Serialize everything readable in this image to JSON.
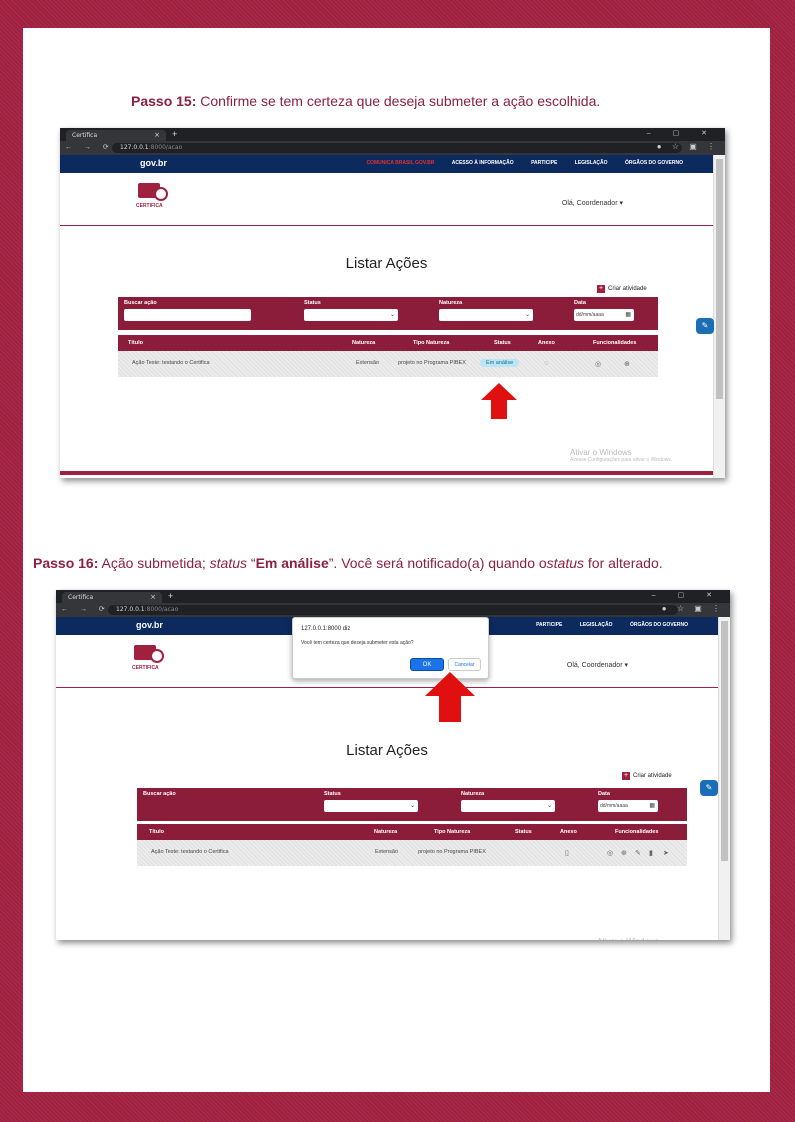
{
  "step15": {
    "label": "Passo 15:",
    "text": "Confirme se tem certeza que deseja submeter a ação escolhida."
  },
  "step16": {
    "label": "Passo 16:",
    "text_a": "Ação submetida; ",
    "status_word": "status",
    "text_b": " “",
    "status_value": "Em análise",
    "text_c": "”. Você será notificado(a) quando o",
    "status_word2": "status",
    "text_d": " for alterado."
  },
  "browser": {
    "tab_title": "Certifica",
    "url_host": "127.0.0.1",
    "url_rest": ":8000/acao"
  },
  "gov": {
    "logo": "gov.br",
    "links": [
      "COMUNICA BRASIL GOV.BR",
      "ACESSO À INFORMAÇÃO",
      "PARTICIPE",
      "LEGISLAÇÃO",
      "ÓRGÃOS DO GOVERNO"
    ]
  },
  "site": {
    "logo_label": "CERTIFICA",
    "user_menu": "Olá, Coordenador ▾",
    "page_title": "Listar Ações",
    "create_label": "Criar atividade"
  },
  "filters": {
    "search_label": "Buscar ação",
    "status_label": "Status",
    "nature_label": "Natureza",
    "date_label": "Data",
    "date_placeholder": "dd/mm/aaaa"
  },
  "table": {
    "headers": [
      "Título",
      "Natureza",
      "Tipo Natureza",
      "Status",
      "Anexo",
      "Funcionalidades"
    ],
    "row": {
      "title": "Ação Teste: testando o Certifica",
      "nature": "Extensão",
      "nature_type": "projeto no Programa PIBEX",
      "status": "Em análise"
    }
  },
  "watermark": {
    "title": "Ativar o Windows",
    "sub": "Acesse Configurações para ativar o Windows."
  },
  "dialog": {
    "host": "127.0.0.1:8000 diz",
    "message": "Você tem certeza que deseja submeter esta ação?",
    "ok": "OK",
    "cancel": "Cancelar"
  },
  "colors": {
    "brand": "#8b1d3b",
    "gov_bar": "#0d2a5e",
    "arrow": "#e01010"
  }
}
